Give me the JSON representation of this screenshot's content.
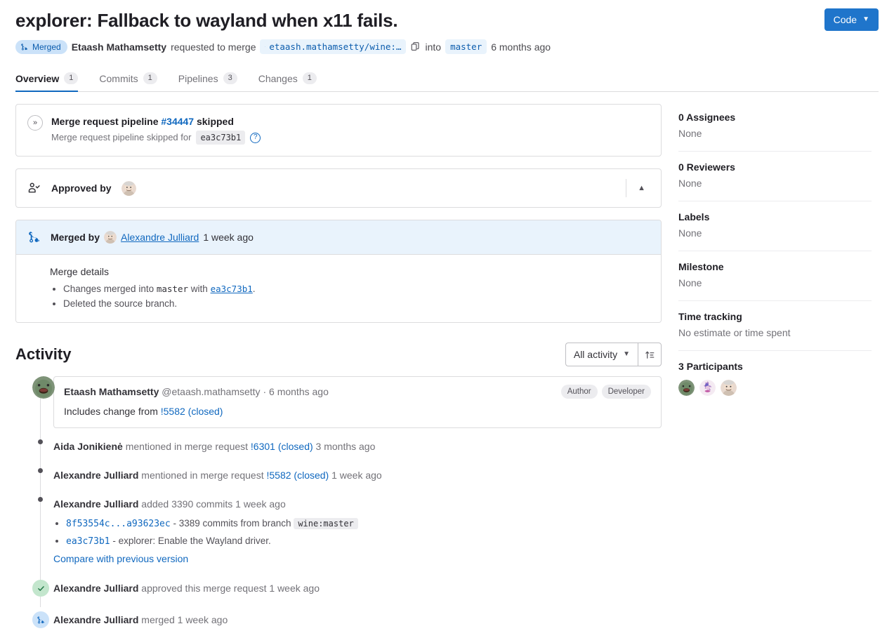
{
  "header": {
    "title": "explorer: Fallback to wayland when x11 fails.",
    "code_button": "Code",
    "code_chevron": "chevron-down-icon",
    "status_badge": "Merged",
    "author": "Etaash Mathamsetty",
    "action_text": "requested to merge",
    "source_branch": "etaash.mathamsetty/wine:…",
    "into_text": "into",
    "target_branch": "master",
    "time": "6 months ago"
  },
  "tabs": [
    {
      "label": "Overview",
      "count": "1",
      "active": true
    },
    {
      "label": "Commits",
      "count": "1",
      "active": false
    },
    {
      "label": "Pipelines",
      "count": "3",
      "active": false
    },
    {
      "label": "Changes",
      "count": "1",
      "active": false
    }
  ],
  "pipeline": {
    "title_prefix": "Merge request pipeline",
    "pipeline_id": "#34447",
    "title_suffix": "skipped",
    "sub_prefix": "Merge request pipeline skipped for",
    "sha": "ea3c73b1",
    "help": "?"
  },
  "approvals": {
    "label": "Approved by",
    "collapse_icon": "chevron-up-icon"
  },
  "merged": {
    "by_label": "Merged by",
    "user": "Alexandre Julliard",
    "time": "1 week ago",
    "details_title": "Merge details",
    "detail_1_prefix": "Changes merged into",
    "detail_1_branch": "master",
    "detail_1_with": "with",
    "detail_1_sha": "ea3c73b1",
    "detail_1_period": ".",
    "detail_2": "Deleted the source branch."
  },
  "activity": {
    "title": "Activity",
    "filter_label": "All activity",
    "filter_chevron": "chevron-down-icon",
    "sort_icon": "sort-ascending-icon",
    "note": {
      "author": "Etaash Mathamsetty",
      "handle": "@etaash.mathamsetty",
      "separator": "·",
      "time": "6 months ago",
      "badges": [
        "Author",
        "Developer"
      ],
      "body_prefix": "Includes change from",
      "body_link": "!5582 (closed)"
    },
    "events": [
      {
        "actor": "Aida Jonikienė",
        "action": "mentioned in merge request",
        "link": "!6301 (closed)",
        "time": "3 months ago",
        "icon": "dot"
      },
      {
        "actor": "Alexandre Julliard",
        "action": "mentioned in merge request",
        "link": "!5582 (closed)",
        "time": "1 week ago",
        "icon": "dot"
      },
      {
        "actor": "Alexandre Julliard",
        "action": "added 3390 commits",
        "link": "",
        "time": "1 week ago",
        "icon": "dot"
      },
      {
        "actor": "Alexandre Julliard",
        "action": "approved this merge request",
        "link": "",
        "time": "1 week ago",
        "icon": "check-circle-icon"
      },
      {
        "actor": "Alexandre Julliard",
        "action": "merged",
        "link": "",
        "time": "1 week ago",
        "icon": "merge-icon"
      }
    ],
    "commits_detail": {
      "range": "8f53554c...a93623ec",
      "range_text": "- 3389 commits from branch",
      "range_branch": "wine:master",
      "single_sha": "ea3c73b1",
      "single_text": "- explorer: Enable the Wayland driver.",
      "compare_link": "Compare with previous version"
    }
  },
  "sidebar": [
    {
      "title": "0 Assignees",
      "value": "None"
    },
    {
      "title": "0 Reviewers",
      "value": "None"
    },
    {
      "title": "Labels",
      "value": "None"
    },
    {
      "title": "Milestone",
      "value": "None"
    },
    {
      "title": "Time tracking",
      "value": "No estimate or time spent"
    }
  ],
  "participants": {
    "title": "3 Participants"
  },
  "colors": {
    "accent": "#1f75cb",
    "link": "#1068bf",
    "merged_bg": "#cbe2f9",
    "merged_fg": "#0b5cad",
    "approved_green": "#c3e6cd"
  }
}
